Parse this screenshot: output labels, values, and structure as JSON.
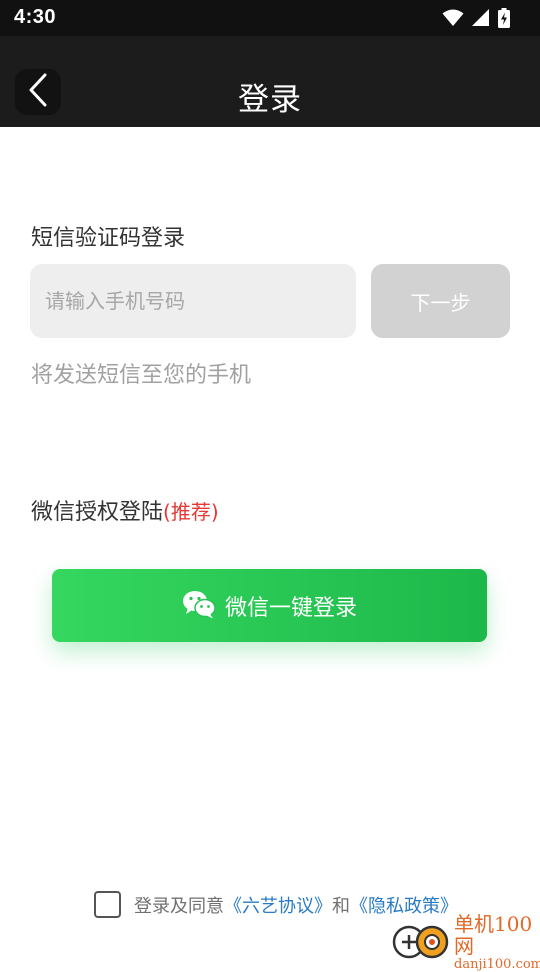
{
  "status_bar": {
    "time": "4:30",
    "icons": [
      "wifi-icon",
      "signal-icon",
      "battery-charging-icon"
    ]
  },
  "nav": {
    "back_icon": "chevron-left-icon",
    "title": "登录"
  },
  "sms_login": {
    "title": "短信验证码登录",
    "phone_value": "",
    "phone_placeholder": "请输入手机号码",
    "next_label": "下一步",
    "hint": "将发送短信至您的手机"
  },
  "wechat_login": {
    "title": "微信授权登陆",
    "recommend": "(推荐)",
    "button_icon": "wechat-icon",
    "button_label": "微信一键登录"
  },
  "agreement": {
    "checked": false,
    "prefix": "登录及同意",
    "terms_link": "《六艺协议》",
    "conjunction": "和",
    "privacy_link": "《隐私政策》"
  },
  "watermark": {
    "line1": "单机100网",
    "line2": "danji100.com"
  },
  "colors": {
    "nav_background": "#1c1c1c",
    "wechat_green": "#22c45a",
    "link_blue": "#2a7bc4",
    "recommend_red": "#e53935",
    "next_button_disabled": "#d2d2d2"
  }
}
